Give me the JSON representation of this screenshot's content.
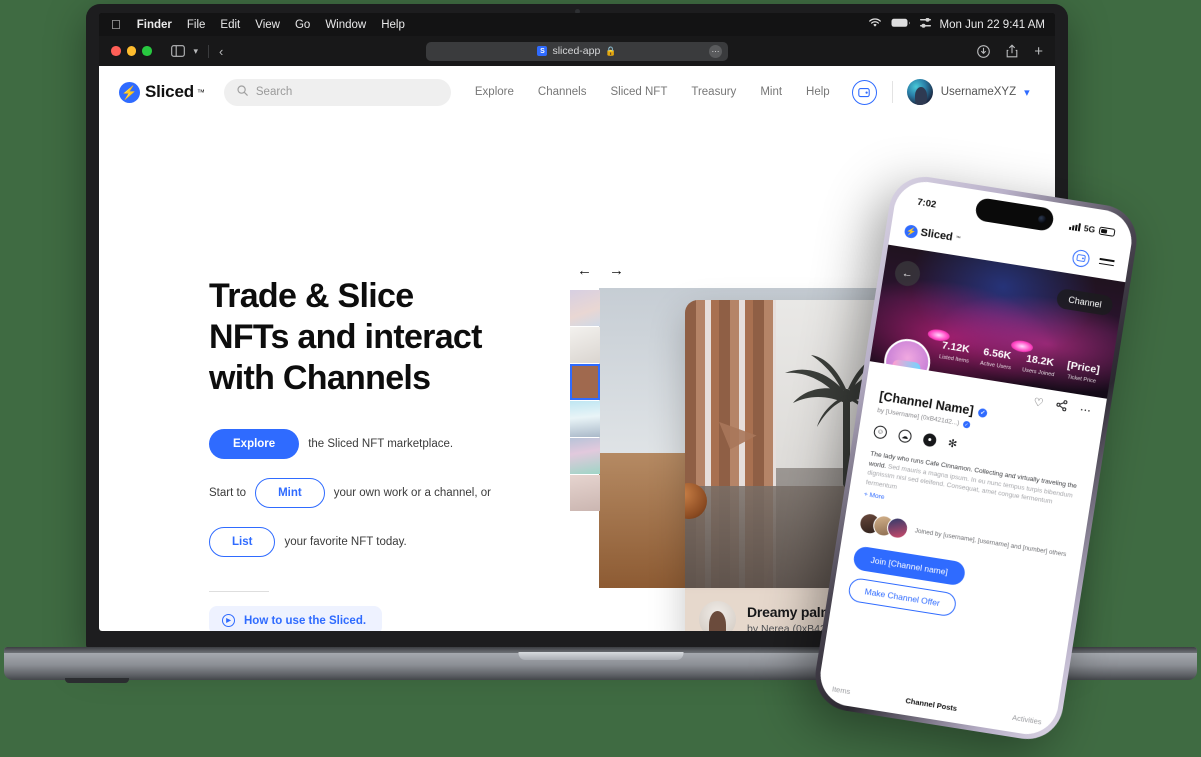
{
  "os": {
    "menubar": {
      "apple_icon": "apple-icon",
      "items": [
        "Finder",
        "File",
        "Edit",
        "View",
        "Go",
        "Window",
        "Help"
      ],
      "status_icons": [
        "wifi-icon",
        "battery-icon",
        "control-center-icon"
      ],
      "datetime": "Mon Jun 22  9:41 AM"
    },
    "browser": {
      "sidebar_icon": "sidebar-icon",
      "chevron_down_icon": "chevron-down-icon",
      "back_icon": "back-arrow-icon",
      "url": "sliced-app",
      "lock_icon": "lock-icon",
      "reload_icon": "more-icon",
      "favicon_letter": "S",
      "right_icons": [
        "download-icon",
        "share-icon",
        "new-tab-icon"
      ]
    }
  },
  "site": {
    "brand": {
      "name": "Sliced",
      "tm": "™",
      "logo_icon": "sliced-bolt-logo"
    },
    "search": {
      "placeholder": "Search",
      "icon": "search-icon"
    },
    "nav_links": [
      "Explore",
      "Channels",
      "Sliced NFT",
      "Treasury",
      "Mint",
      "Help"
    ],
    "wallet_icon": "wallet-icon",
    "user": {
      "name": "UsernameXYZ",
      "avatar": "user-avatar",
      "chevron": "chevron-down-icon"
    }
  },
  "hero": {
    "headline_lines": [
      "Trade & Slice",
      "NFTs and interact",
      "with Channels"
    ],
    "cta": {
      "explore_label": "Explore",
      "explore_text": "the Sliced NFT marketplace.",
      "start_prefix": "Start to",
      "mint_label": "Mint",
      "mint_text": "your own work or a channel, or",
      "list_label": "List",
      "list_text": "your favorite NFT today."
    },
    "howto": {
      "label": "How to use the Sliced.",
      "icon": "play-circle-icon"
    }
  },
  "carousel": {
    "prev_icon": "arrow-left-icon",
    "next_icon": "arrow-right-icon",
    "thumbnails": [
      "thumb-1",
      "thumb-2",
      "thumb-3",
      "thumb-4",
      "thumb-5",
      "thumb-6"
    ],
    "selected_index": 2,
    "featured": {
      "title": "Dreamy palm par...",
      "author": "by Nerea (0xB421d2...)",
      "artwork_alt": "palm-tree-corridor-artwork"
    }
  },
  "phone": {
    "status": {
      "time": "7:02",
      "signal": "5G",
      "signal_icon": "cellular-bars-icon",
      "battery_icon": "battery-icon"
    },
    "nav": {
      "brand": "Sliced",
      "tm": "™",
      "wallet_icon": "wallet-icon",
      "menu_icon": "hamburger-menu-icon"
    },
    "hero": {
      "back_icon": "back-arrow-icon",
      "chip_label": "Channel",
      "artwork_alt": "neon-car-artwork"
    },
    "stats": [
      {
        "value": "7.12K",
        "label": "Listed Items"
      },
      {
        "value": "6.56K",
        "label": "Active Users"
      },
      {
        "value": "18.2K",
        "label": "Users Joined"
      },
      {
        "value": "[Price]",
        "label": "Ticket Price"
      }
    ],
    "channel": {
      "name": "[Channel Name]",
      "by": "by [Username] (0xB421d2...)",
      "actions": [
        "heart-icon",
        "share-icon",
        "more-icon"
      ],
      "socials": [
        "discord-icon",
        "globe-icon",
        "discord-alt-icon",
        "twitter-icon"
      ],
      "description_strong": "The lady who runs Cafe Cinnamon. Collecting and virtually traveling the world.",
      "description_dim": "Sed mauris a magna ipsum. In eu nunc tempus turpis bibendum dignissim nisl sed eleifend. Consequat, amet congue fermentum fermentum",
      "more_label": "+ More"
    },
    "joined": {
      "text": "Joined by [username], [username] and [number] others",
      "avatars": [
        "member-1",
        "member-2",
        "member-3"
      ]
    },
    "buttons": {
      "join": "Join [Channel name]",
      "offer": "Make Channel Offer"
    },
    "tabs": [
      "Items",
      "Channel Posts",
      "Activities"
    ],
    "active_tab_index": 1
  },
  "colors": {
    "background": "#3f6b42",
    "accent": "#2f6bff",
    "accent_soft": "#eef2ff",
    "text_dark": "#0d0d0d",
    "text_muted": "#777777"
  }
}
